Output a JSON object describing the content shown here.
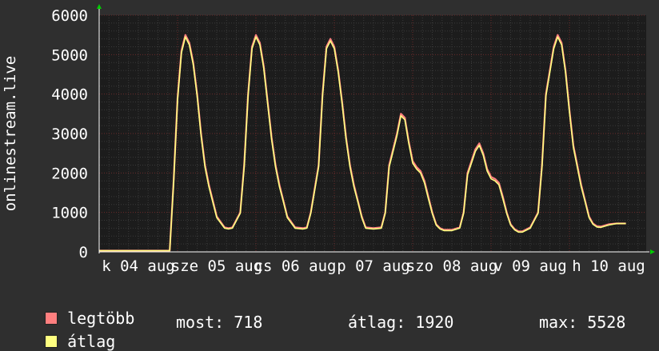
{
  "chart_data": {
    "type": "line",
    "ylabel": "onlinestream.live",
    "ylim": [
      0,
      6000
    ],
    "y_ticks": [
      "0",
      "1000",
      "2000",
      "3000",
      "4000",
      "5000",
      "6000"
    ],
    "x_ticks": [
      "k 04 aug",
      "sze 05 aug",
      "cs 06 aug",
      "p 07 aug",
      "szo 08 aug",
      "v 09 aug",
      "h 10 aug"
    ],
    "grid": true,
    "series": [
      {
        "name": "legtöbb",
        "color": "#ff7f7f",
        "x": [
          0,
          0.3,
          0.6,
          0.9,
          0.95,
          1.0,
          1.05,
          1.1,
          1.15,
          1.2,
          1.25,
          1.3,
          1.35,
          1.4,
          1.5,
          1.6,
          1.65,
          1.7,
          1.8,
          1.85,
          1.9,
          1.95,
          2.0,
          2.05,
          2.1,
          2.15,
          2.2,
          2.25,
          2.3,
          2.35,
          2.4,
          2.5,
          2.6,
          2.65,
          2.7,
          2.8,
          2.85,
          2.9,
          2.95,
          3.0,
          3.05,
          3.1,
          3.15,
          3.2,
          3.25,
          3.3,
          3.35,
          3.4,
          3.5,
          3.6,
          3.65,
          3.7,
          3.8,
          3.85,
          3.9,
          3.95,
          4.0,
          4.05,
          4.1,
          4.15,
          4.2,
          4.25,
          4.3,
          4.35,
          4.4,
          4.5,
          4.6,
          4.65,
          4.7,
          4.8,
          4.85,
          4.9,
          4.95,
          5.0,
          5.05,
          5.1,
          5.15,
          5.2,
          5.25,
          5.3,
          5.35,
          5.4,
          5.5,
          5.6,
          5.65,
          5.7,
          5.8,
          5.85,
          5.9,
          5.95,
          6.0,
          6.05,
          6.1,
          6.15,
          6.2,
          6.25,
          6.3,
          6.35,
          6.4,
          6.5,
          6.6,
          6.65,
          6.72
        ],
        "values": [
          30,
          30,
          30,
          30,
          1800,
          3900,
          5100,
          5500,
          5300,
          4800,
          4000,
          3000,
          2200,
          1700,
          900,
          620,
          600,
          620,
          1000,
          2200,
          4000,
          5200,
          5500,
          5300,
          4700,
          3800,
          2900,
          2200,
          1700,
          1300,
          900,
          620,
          600,
          620,
          1000,
          2200,
          4000,
          5200,
          5400,
          5200,
          4600,
          3800,
          2900,
          2200,
          1700,
          1300,
          900,
          620,
          600,
          620,
          1000,
          2200,
          3000,
          3500,
          3400,
          2800,
          2300,
          2150,
          2050,
          1800,
          1400,
          1000,
          700,
          600,
          560,
          560,
          620,
          1000,
          2000,
          2600,
          2750,
          2500,
          2100,
          1900,
          1850,
          1750,
          1400,
          1000,
          700,
          580,
          520,
          520,
          620,
          1000,
          2200,
          4000,
          5200,
          5500,
          5300,
          4600,
          3600,
          2700,
          2200,
          1700,
          1300,
          900,
          720,
          650,
          640,
          700,
          720,
          720,
          720
        ]
      },
      {
        "name": "átlag",
        "color": "#ffff80",
        "x": [
          0,
          0.3,
          0.6,
          0.9,
          0.95,
          1.0,
          1.05,
          1.1,
          1.15,
          1.2,
          1.25,
          1.3,
          1.35,
          1.4,
          1.5,
          1.6,
          1.65,
          1.7,
          1.8,
          1.85,
          1.9,
          1.95,
          2.0,
          2.05,
          2.1,
          2.15,
          2.2,
          2.25,
          2.3,
          2.35,
          2.4,
          2.5,
          2.6,
          2.65,
          2.7,
          2.8,
          2.85,
          2.9,
          2.95,
          3.0,
          3.05,
          3.1,
          3.15,
          3.2,
          3.25,
          3.3,
          3.35,
          3.4,
          3.5,
          3.6,
          3.65,
          3.7,
          3.8,
          3.85,
          3.9,
          3.95,
          4.0,
          4.05,
          4.1,
          4.15,
          4.2,
          4.25,
          4.3,
          4.35,
          4.4,
          4.5,
          4.6,
          4.65,
          4.7,
          4.8,
          4.85,
          4.9,
          4.95,
          5.0,
          5.05,
          5.1,
          5.15,
          5.2,
          5.25,
          5.3,
          5.35,
          5.4,
          5.5,
          5.6,
          5.65,
          5.7,
          5.8,
          5.85,
          5.9,
          5.95,
          6.0,
          6.05,
          6.1,
          6.15,
          6.2,
          6.25,
          6.3,
          6.35,
          6.4,
          6.5,
          6.6,
          6.65,
          6.72
        ],
        "values": [
          30,
          30,
          30,
          30,
          1750,
          3850,
          5050,
          5450,
          5250,
          4750,
          3950,
          2950,
          2150,
          1650,
          870,
          600,
          580,
          600,
          980,
          2150,
          3950,
          5150,
          5450,
          5250,
          4650,
          3750,
          2850,
          2150,
          1650,
          1270,
          870,
          600,
          580,
          600,
          980,
          2150,
          3950,
          5150,
          5350,
          5150,
          4550,
          3750,
          2850,
          2150,
          1650,
          1270,
          870,
          600,
          580,
          600,
          980,
          2150,
          2950,
          3450,
          3350,
          2750,
          2250,
          2100,
          2000,
          1750,
          1350,
          970,
          680,
          580,
          540,
          540,
          600,
          980,
          1950,
          2550,
          2700,
          2450,
          2050,
          1850,
          1800,
          1700,
          1350,
          970,
          680,
          560,
          500,
          500,
          600,
          980,
          2150,
          3950,
          5150,
          5450,
          5250,
          4550,
          3550,
          2650,
          2150,
          1650,
          1270,
          870,
          700,
          630,
          620,
          680,
          718,
          718,
          718
        ]
      }
    ]
  },
  "legend": {
    "items": [
      {
        "label": "legtöbb",
        "color": "#ff7f7f"
      },
      {
        "label": "átlag",
        "color": "#ffff80"
      }
    ],
    "stats": {
      "most": "most: 718",
      "atlag": "átlag: 1920",
      "max": "max: 5528"
    }
  }
}
